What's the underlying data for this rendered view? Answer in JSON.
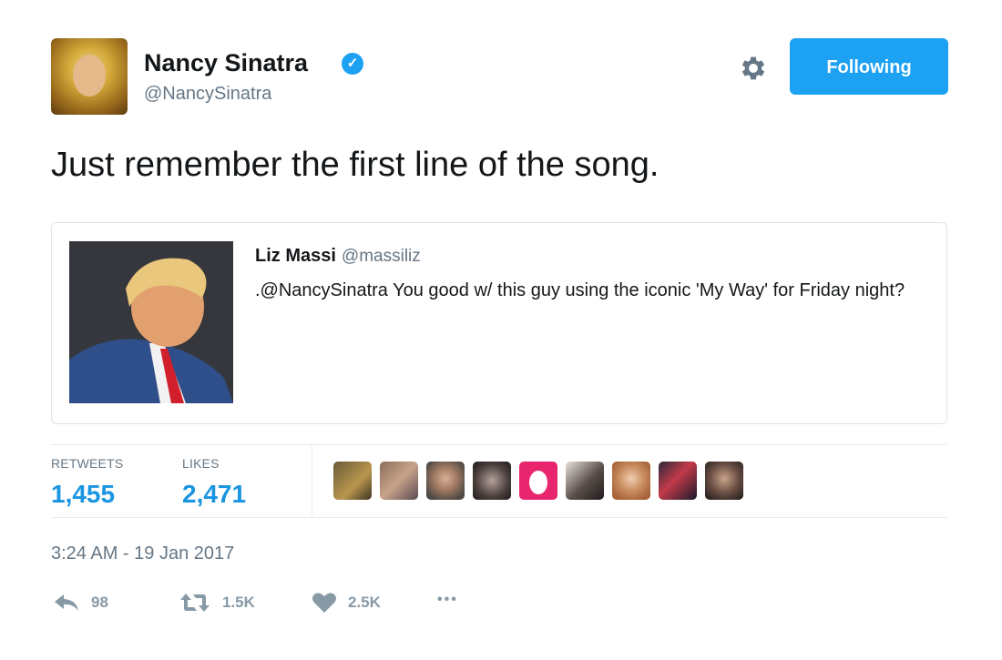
{
  "author": {
    "display_name": "Nancy Sinatra",
    "handle": "@NancySinatra",
    "verified_glyph": "✓"
  },
  "header": {
    "follow_button_label": "Following",
    "settings_icon": "gear-icon"
  },
  "tweet": {
    "text": "Just remember the first line of the song.",
    "timestamp": "3:24 AM - 19 Jan 2017"
  },
  "quoted_tweet": {
    "author_name": "Liz Massi",
    "author_handle": "@massiliz",
    "text": ".@NancySinatra You good w/ this guy using the iconic 'My Way' for Friday night?"
  },
  "stats": {
    "retweets_label": "RETWEETS",
    "retweets_value": "1,455",
    "likes_label": "LIKES",
    "likes_value": "2,471"
  },
  "actions": {
    "reply_count": "98",
    "retweet_count": "1.5K",
    "like_count": "2.5K",
    "more_glyph": "•••"
  },
  "colors": {
    "accent": "#1da1f2",
    "link_blue": "#1b95e0",
    "muted": "#657786",
    "icon_gray": "#8899a6"
  }
}
